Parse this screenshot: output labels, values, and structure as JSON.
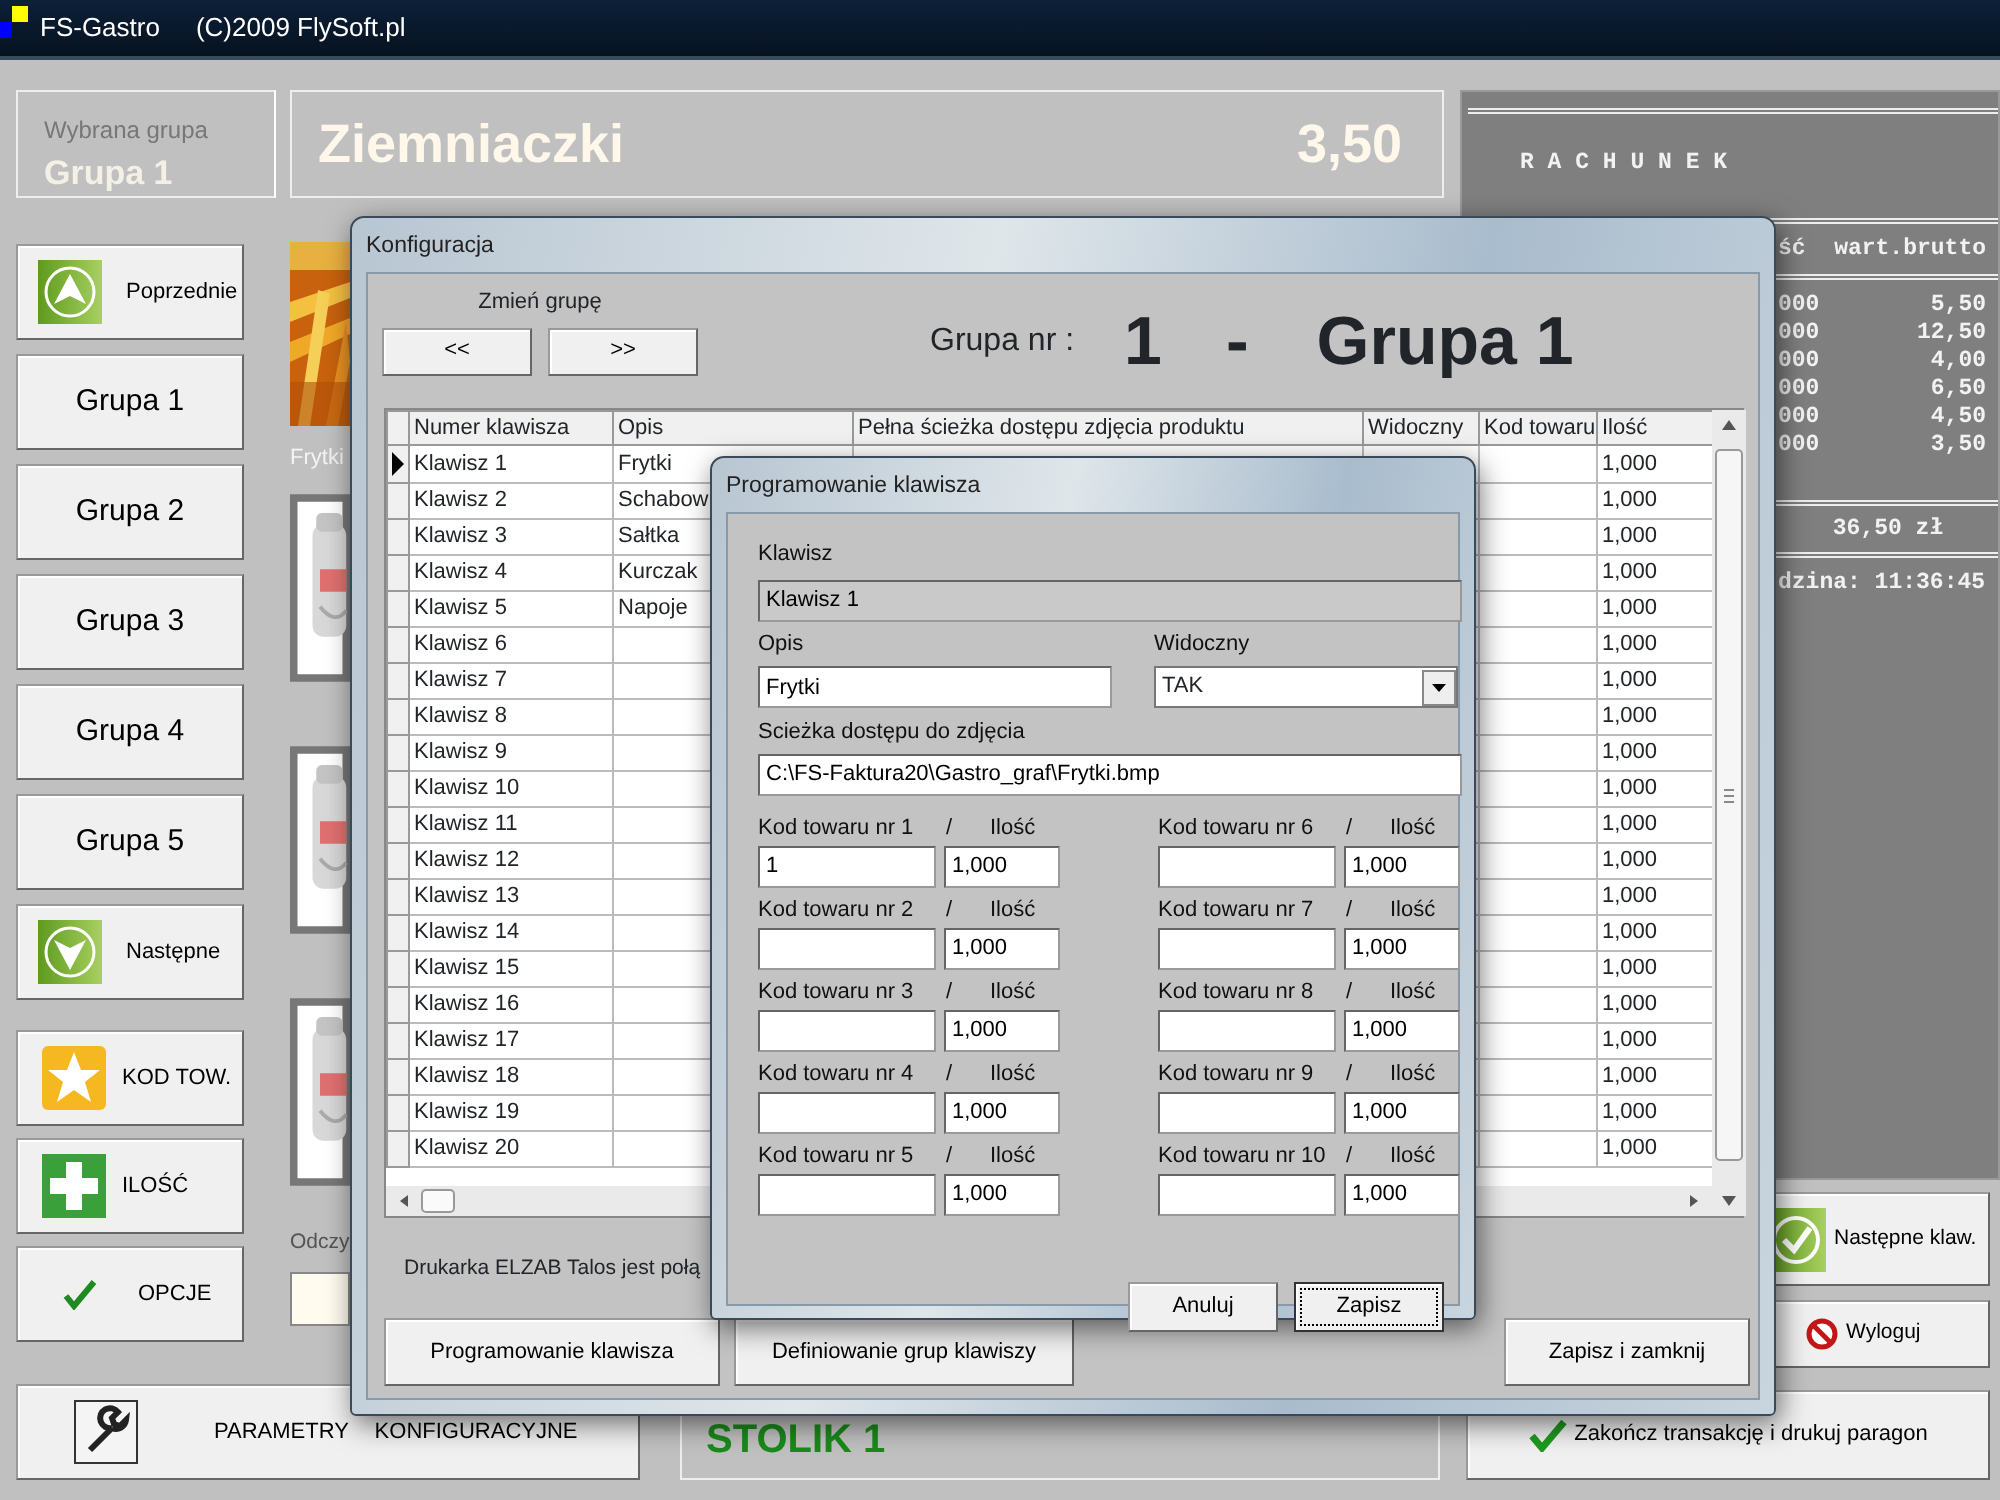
{
  "title_bar": {
    "title": "FS-Gastro",
    "copyright": "(C)2009 FlySoft.pl"
  },
  "selected_group": {
    "label": "Wybrana grupa",
    "value": "Grupa 1"
  },
  "product": {
    "name": "Ziemniaczki",
    "price": "3,50"
  },
  "nav_buttons": [
    {
      "kind": "up",
      "label": "Poprzednie"
    },
    {
      "kind": "text",
      "label": "Grupa 1"
    },
    {
      "kind": "text",
      "label": "Grupa 2"
    },
    {
      "kind": "text",
      "label": "Grupa 3"
    },
    {
      "kind": "text",
      "label": "Grupa 4"
    },
    {
      "kind": "text",
      "label": "Grupa 5"
    },
    {
      "kind": "down",
      "label": "Następne"
    }
  ],
  "tool_buttons": [
    {
      "kind": "star",
      "label": "KOD TOW."
    },
    {
      "kind": "plus",
      "label": "ILOŚĆ"
    },
    {
      "kind": "check",
      "label": "OPCJE"
    }
  ],
  "product_tiles": [
    {
      "kind": "fries",
      "label": "Frytki"
    },
    {
      "kind": "jar"
    },
    {
      "kind": "jar"
    },
    {
      "kind": "jar"
    }
  ],
  "reader": {
    "label": "Odczy"
  },
  "receipt": {
    "title": "R A C H U N E K",
    "header": [
      "ść",
      "wart.brutto"
    ],
    "lines": [
      {
        "qty": "000",
        "value": "5,50"
      },
      {
        "qty": "000",
        "value": "12,50"
      },
      {
        "qty": "000",
        "value": "4,00"
      },
      {
        "qty": "000",
        "value": "6,50"
      },
      {
        "qty": "000",
        "value": "4,50"
      },
      {
        "qty": "000",
        "value": "3,50"
      }
    ],
    "total": "36,50 zł",
    "time": "dzina: 11:36:45"
  },
  "right_buttons": [
    {
      "kind": "okbox",
      "label": "Następne klaw."
    },
    {
      "kind": "no",
      "label": "Wyloguj"
    }
  ],
  "bottom": {
    "settings_button": "PARAMETRY KONFIGURACYJNE",
    "table_name": "STOLIK 1",
    "finish_button": "Zakończ transakcję i drukuj paragon"
  },
  "config_dialog": {
    "title": "Konfiguracja",
    "change_label": "Zmień grupę",
    "prev": "<<",
    "next": ">>",
    "group_label": "Grupa nr :",
    "group_number": "1",
    "separator": "-",
    "group_name": "Grupa 1",
    "columns": [
      "Numer klawisza",
      "Opis",
      "Pełna ścieżka dostępu zdjęcia produktu",
      "Widoczny",
      "Kod towaru",
      "Ilość"
    ],
    "rows": [
      {
        "key": "Klawisz 1",
        "description": "Frytki",
        "quantity": "1,000",
        "selected": true
      },
      {
        "key": "Klawisz 2",
        "description": "Schabow",
        "quantity": "1,000",
        "selected": false
      },
      {
        "key": "Klawisz 3",
        "description": "Sałtka",
        "quantity": "1,000",
        "selected": false
      },
      {
        "key": "Klawisz 4",
        "description": "Kurczak",
        "quantity": "1,000",
        "selected": false
      },
      {
        "key": "Klawisz 5",
        "description": "Napoje",
        "quantity": "1,000",
        "selected": false
      },
      {
        "key": "Klawisz 6",
        "quantity": "1,000",
        "selected": false
      },
      {
        "key": "Klawisz 7",
        "quantity": "1,000",
        "selected": false
      },
      {
        "key": "Klawisz 8",
        "quantity": "1,000",
        "selected": false
      },
      {
        "key": "Klawisz 9",
        "quantity": "1,000",
        "selected": false
      },
      {
        "key": "Klawisz 10",
        "quantity": "1,000",
        "selected": false
      },
      {
        "key": "Klawisz 11",
        "quantity": "1,000",
        "selected": false
      },
      {
        "key": "Klawisz 12",
        "quantity": "1,000",
        "selected": false
      },
      {
        "key": "Klawisz 13",
        "quantity": "1,000",
        "selected": false
      },
      {
        "key": "Klawisz 14",
        "quantity": "1,000",
        "selected": false
      },
      {
        "key": "Klawisz 15",
        "quantity": "1,000",
        "selected": false
      },
      {
        "key": "Klawisz 16",
        "quantity": "1,000",
        "selected": false
      },
      {
        "key": "Klawisz 17",
        "quantity": "1,000",
        "selected": false
      },
      {
        "key": "Klawisz 18",
        "quantity": "1,000",
        "selected": false
      },
      {
        "key": "Klawisz 19",
        "quantity": "1,000",
        "selected": false
      },
      {
        "key": "Klawisz 20",
        "quantity": "1,000",
        "selected": false
      }
    ],
    "status": "Drukarka ELZAB Talos jest połą",
    "buttons": [
      "Programowanie klawisza",
      "Definiowanie grup klawiszy",
      "Zapisz i zamknij"
    ]
  },
  "key_dialog": {
    "title": "Programowanie klawisza",
    "key_label": "Klawisz",
    "key_field": {
      "value": "Klawisz 1",
      "disabled": true
    },
    "description_label": "Opis",
    "description": "Frytki",
    "visible_label": "Widoczny",
    "visible": "TAK",
    "path_label": "Scieżka dostępu do zdjęcia",
    "path": "C:\\FS-Faktura20\\Gastro_graf\\Frytki.bmp",
    "codes": [
      {
        "label": "Kod towaru nr 1",
        "slash": "/",
        "qty_label": "Ilość",
        "code": "1",
        "qty": "1,000"
      },
      {
        "label": "Kod towaru nr 6",
        "slash": "/",
        "qty_label": "Ilość",
        "qty": "1,000"
      },
      {
        "label": "Kod towaru nr 2",
        "slash": "/",
        "qty_label": "Ilość",
        "qty": "1,000"
      },
      {
        "label": "Kod towaru nr 7",
        "slash": "/",
        "qty_label": "Ilość",
        "qty": "1,000"
      },
      {
        "label": "Kod towaru nr 3",
        "slash": "/",
        "qty_label": "Ilość",
        "qty": "1,000"
      },
      {
        "label": "Kod towaru nr 8",
        "slash": "/",
        "qty_label": "Ilość",
        "qty": "1,000"
      },
      {
        "label": "Kod towaru nr 4",
        "slash": "/",
        "qty_label": "Ilość",
        "qty": "1,000"
      },
      {
        "label": "Kod towaru nr 9",
        "slash": "/",
        "qty_label": "Ilość",
        "qty": "1,000"
      },
      {
        "label": "Kod towaru nr 5",
        "slash": "/",
        "qty_label": "Ilość",
        "qty": "1,000"
      },
      {
        "label": "Kod towaru nr 10",
        "slash": "/",
        "qty_label": "Ilość",
        "qty": "1,000"
      }
    ],
    "buttons": [
      {
        "label": "Anuluj",
        "focused": false
      },
      {
        "label": "Zapisz",
        "focused": true
      }
    ]
  }
}
